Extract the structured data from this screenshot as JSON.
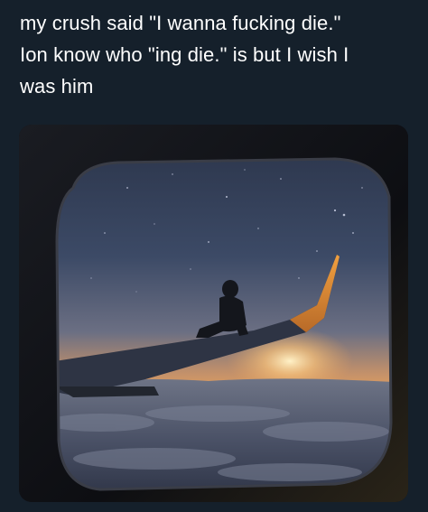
{
  "tweet": {
    "text_lines": [
      "my crush said \"I wanna fucking die.\"",
      "Ion know who \"ing die.\" is but I wish I",
      "was him"
    ]
  },
  "media": {
    "subject": "person sitting on airplane wing seen through window at sunset above clouds",
    "colors": {
      "background": "#15202b",
      "text": "#ffffff",
      "sky_top": "#3c4a66",
      "horizon": "#e8a25a",
      "wing_tip": "#d8893a"
    }
  }
}
